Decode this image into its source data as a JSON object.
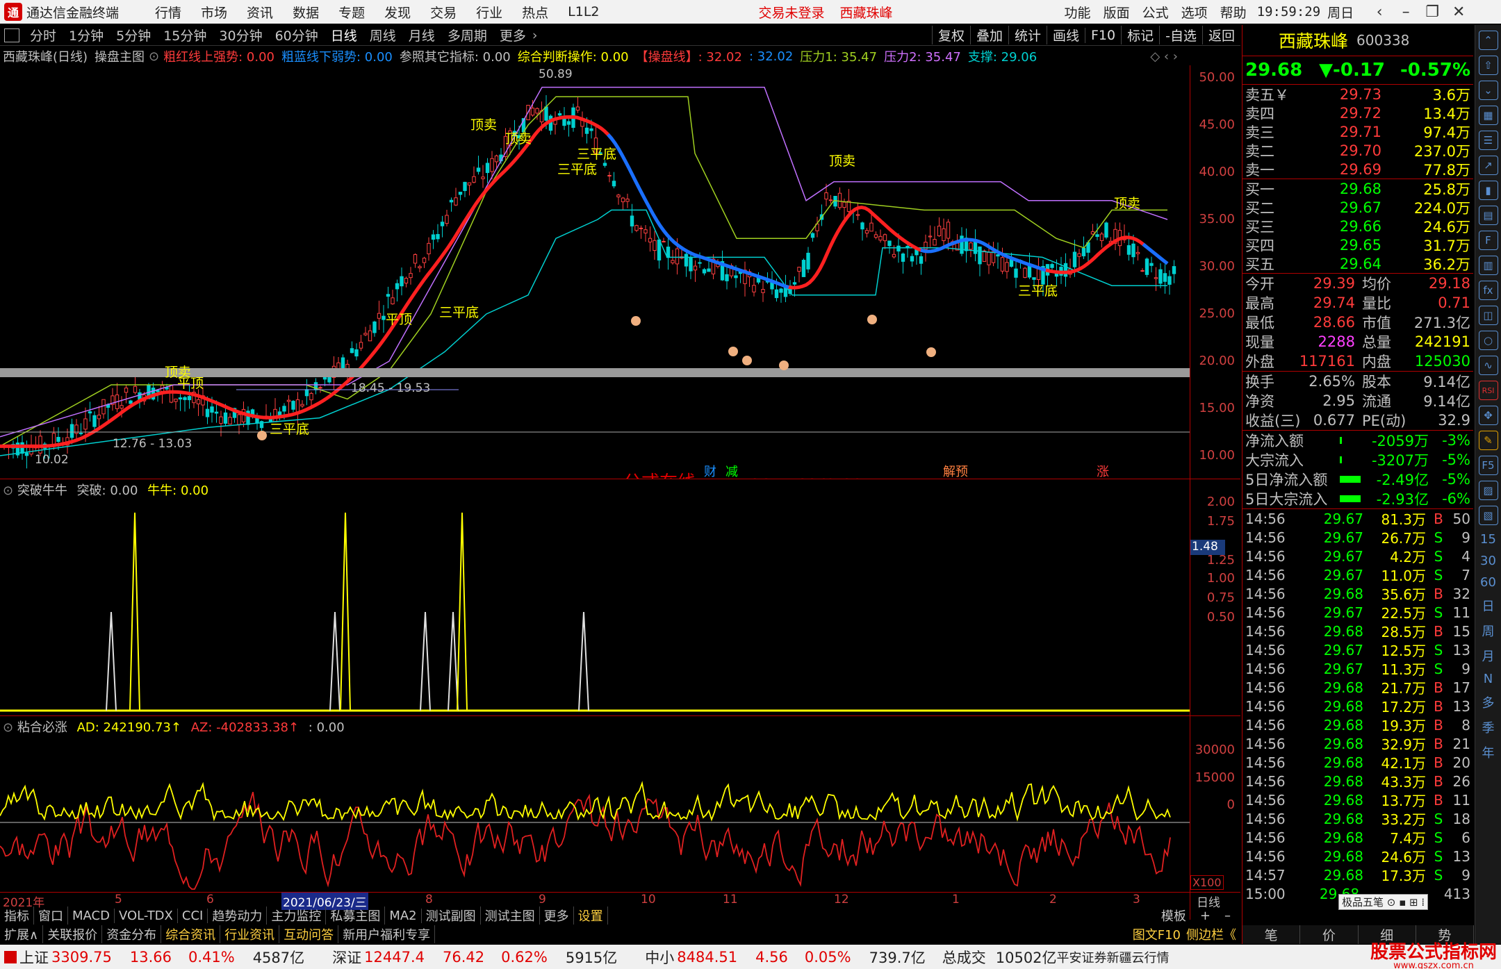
{
  "titlebar": {
    "app_name": "通达信金融终端",
    "menus": [
      "行情",
      "市场",
      "资讯",
      "数据",
      "专题",
      "发现",
      "交易",
      "行业",
      "热点",
      "L1L2"
    ],
    "status_login": "交易未登录",
    "stock_name": "西藏珠峰",
    "right_menus": [
      "功能",
      "版面",
      "公式",
      "选项",
      "帮助"
    ],
    "time": "19:59:29",
    "weekday": "周日"
  },
  "toolbar": {
    "items": [
      "分时",
      "1分钟",
      "5分钟",
      "15分钟",
      "30分钟",
      "60分钟",
      "日线",
      "周线",
      "月线",
      "多周期",
      "更多"
    ],
    "right_items": [
      "复权",
      "叠加",
      "统计",
      "画线",
      "F10",
      "标记",
      "-自选",
      "返回"
    ]
  },
  "infoline": {
    "title": "西藏珠峰(日线)",
    "indicator": "操盘主图",
    "s1": "粗红线上强势: 0.00",
    "s2": "粗蓝线下弱势: 0.00",
    "s3": "参照其它指标: 0.00",
    "s4": "综合判断操作: 0.00",
    "s5": "【操盘线】: 32.02",
    "s6": ": 32.02",
    "s7": "压力1: 35.47",
    "s8": "压力2: 35.47",
    "s9": "支撑: 29.06"
  },
  "main_axis": [
    "50.00",
    "45.00",
    "40.00",
    "35.00",
    "30.00",
    "25.00",
    "20.00",
    "15.00",
    "10.00"
  ],
  "main_labels": {
    "peak": "50.89",
    "range1": "18.45 - 19.53",
    "range2": "12.76 - 13.03",
    "low": "10.02",
    "sell1": "顶卖",
    "sell2": "顶卖",
    "top1": "平顶",
    "top2": "平顶",
    "bottom": "三平底",
    "bottom2": "三平底",
    "bottom3": "三平底",
    "bottom4": "三平底",
    "bottom5": "三平底",
    "sell3": "顶卖",
    "sell4": "顶卖",
    "sell5": "顶卖",
    "markers": [
      "财",
      "减",
      "解预",
      "涨"
    ],
    "watermark": "公式在线  www.gszx.com.cn"
  },
  "panel2": {
    "name": "突破牛牛",
    "v1": "突破: 0.00",
    "v2": "牛牛: 0.00",
    "axis": [
      "2.00",
      "1.75",
      "1.25",
      "1.00",
      "0.75",
      "0.50"
    ],
    "cursor_value": "1.48"
  },
  "panel3": {
    "name": "粘合必涨",
    "v1": "AD: 242190.73↑",
    "v2": "AZ: -402833.38↑",
    "v3": ": 0.00",
    "axis": [
      "30000",
      "15000",
      "0"
    ],
    "scale": "X100"
  },
  "xaxis": {
    "labels": [
      "2021年",
      "5",
      "6",
      "2021/06/23/三",
      "8",
      "9",
      "10",
      "11",
      "12",
      "1",
      "2",
      "3"
    ],
    "period": "日线"
  },
  "tabs1": [
    "指标",
    "窗口",
    "MACD",
    "VOL-TDX",
    "CCI",
    "趋势动力",
    "主力监控",
    "私募主图",
    "MA2",
    "测试副图",
    "测试主图",
    "更多",
    "设置"
  ],
  "tabs1_right": "模板",
  "tabs2": [
    "扩展∧",
    "关联报价",
    "资金分布",
    "综合资讯",
    "行业资讯",
    "互动问答",
    "新用户福利专享"
  ],
  "tabs2_right": [
    "图文F10",
    "侧边栏《"
  ],
  "quote": {
    "name": "西藏珠峰",
    "code": "600338",
    "price": "29.68",
    "change": "▼-0.17",
    "pct": "-0.57%",
    "asks": [
      {
        "l": "卖五￥",
        "p": "29.73",
        "v": "3.6万"
      },
      {
        "l": "卖四",
        "p": "29.72",
        "v": "13.4万"
      },
      {
        "l": "卖三",
        "p": "29.71",
        "v": "97.4万"
      },
      {
        "l": "卖二",
        "p": "29.70",
        "v": "237.0万"
      },
      {
        "l": "卖一",
        "p": "29.69",
        "v": "77.8万"
      }
    ],
    "bids": [
      {
        "l": "买一",
        "p": "29.68",
        "v": "25.8万"
      },
      {
        "l": "买二",
        "p": "29.67",
        "v": "224.0万"
      },
      {
        "l": "买三",
        "p": "29.66",
        "v": "24.6万"
      },
      {
        "l": "买四",
        "p": "29.65",
        "v": "31.7万"
      },
      {
        "l": "买五",
        "p": "29.64",
        "v": "36.2万"
      }
    ],
    "info1": [
      {
        "a": "今开",
        "b": "29.39",
        "bc": "#ff3b3b",
        "c": "均价",
        "d": "29.18",
        "dc": "#ff3b3b"
      },
      {
        "a": "最高",
        "b": "29.74",
        "bc": "#ff3b3b",
        "c": "量比",
        "d": "0.71",
        "dc": "#ff3b3b"
      },
      {
        "a": "最低",
        "b": "28.66",
        "bc": "#ff3b3b",
        "c": "市值",
        "d": "271.3亿",
        "dc": "#c0c0c0"
      },
      {
        "a": "现量",
        "b": "2288",
        "bc": "#ff40ff",
        "c": "总量",
        "d": "242191",
        "dc": "#ffff00"
      },
      {
        "a": "外盘",
        "b": "117161",
        "bc": "#ff3b3b",
        "c": "内盘",
        "d": "125030",
        "dc": "#00ff00"
      }
    ],
    "info2": [
      {
        "a": "换手",
        "b": "2.65%",
        "c": "股本",
        "d": "9.14亿"
      },
      {
        "a": "净资",
        "b": "2.95",
        "c": "流通",
        "d": "9.14亿"
      },
      {
        "a": "收益(三)",
        "b": "0.677",
        "c": "PE(动)",
        "d": "32.9"
      }
    ],
    "flows": [
      {
        "l": "净流入额",
        "v": "-2059万",
        "p": "-3%"
      },
      {
        "l": "大宗流入",
        "v": "-3207万",
        "p": "-5%"
      },
      {
        "l": "5日净流入额",
        "v": "-2.49亿",
        "p": "-5%"
      },
      {
        "l": "5日大宗流入",
        "v": "-2.93亿",
        "p": "-6%"
      }
    ],
    "ticks": [
      {
        "t": "14:56",
        "p": "29.67",
        "v": "81.3万",
        "d": "B",
        "n": "50"
      },
      {
        "t": "14:56",
        "p": "29.67",
        "v": "26.7万",
        "d": "S",
        "n": "9"
      },
      {
        "t": "14:56",
        "p": "29.67",
        "v": "4.2万",
        "d": "S",
        "n": "4"
      },
      {
        "t": "14:56",
        "p": "29.67",
        "v": "11.0万",
        "d": "S",
        "n": "7"
      },
      {
        "t": "14:56",
        "p": "29.68",
        "v": "35.6万",
        "d": "B",
        "n": "32"
      },
      {
        "t": "14:56",
        "p": "29.67",
        "v": "22.5万",
        "d": "S",
        "n": "11"
      },
      {
        "t": "14:56",
        "p": "29.68",
        "v": "28.5万",
        "d": "B",
        "n": "15"
      },
      {
        "t": "14:56",
        "p": "29.67",
        "v": "12.5万",
        "d": "S",
        "n": "13"
      },
      {
        "t": "14:56",
        "p": "29.67",
        "v": "11.3万",
        "d": "S",
        "n": "9"
      },
      {
        "t": "14:56",
        "p": "29.68",
        "v": "21.7万",
        "d": "B",
        "n": "17"
      },
      {
        "t": "14:56",
        "p": "29.68",
        "v": "17.2万",
        "d": "B",
        "n": "13"
      },
      {
        "t": "14:56",
        "p": "29.68",
        "v": "19.3万",
        "d": "B",
        "n": "8"
      },
      {
        "t": "14:56",
        "p": "29.68",
        "v": "32.9万",
        "d": "B",
        "n": "21"
      },
      {
        "t": "14:56",
        "p": "29.68",
        "v": "42.1万",
        "d": "B",
        "n": "20"
      },
      {
        "t": "14:56",
        "p": "29.68",
        "v": "43.3万",
        "d": "B",
        "n": "26"
      },
      {
        "t": "14:56",
        "p": "29.68",
        "v": "13.7万",
        "d": "B",
        "n": "11"
      },
      {
        "t": "14:56",
        "p": "29.68",
        "v": "33.2万",
        "d": "S",
        "n": "18"
      },
      {
        "t": "14:56",
        "p": "29.68",
        "v": "7.4万",
        "d": "S",
        "n": "6"
      },
      {
        "t": "14:56",
        "p": "29.68",
        "v": "24.6万",
        "d": "S",
        "n": "13"
      },
      {
        "t": "14:57",
        "p": "29.68",
        "v": "17.3万",
        "d": "S",
        "n": "9"
      },
      {
        "t": "15:00",
        "p": "29.68",
        "v": "",
        "d": "",
        "n": "413"
      }
    ],
    "tooltip": "极品五笔",
    "bottom_tabs": [
      "笔",
      "价",
      "细",
      "势"
    ]
  },
  "sidebar": {
    "labels": [
      "日",
      "周",
      "月",
      "N",
      "多",
      "季",
      "年"
    ]
  },
  "statusbar": {
    "sh_label": "上证",
    "sh_val": "3309.75",
    "sh_chg": "13.66",
    "sh_pct": "0.41%",
    "sh_amt": "4587亿",
    "sz_label": "深证",
    "sz_val": "12447.4",
    "sz_chg": "76.42",
    "sz_pct": "0.62%",
    "sz_amt": "5915亿",
    "zx_label": "中小",
    "zx_val": "8484.51",
    "zx_chg": "4.56",
    "zx_pct": "0.05%",
    "zx_amt": "739.7亿",
    "total_label": "总成交",
    "total_val": "10502亿",
    "broker": "平安证券新疆云行情",
    "brand": "股票公式指标网",
    "brand_url": "www.gszx.com.cn"
  },
  "colors": {
    "red": "#ff3b3b",
    "green": "#00ff00",
    "yellow": "#ffff00",
    "blue": "#1a6fff",
    "cyan": "#00d0d0"
  }
}
